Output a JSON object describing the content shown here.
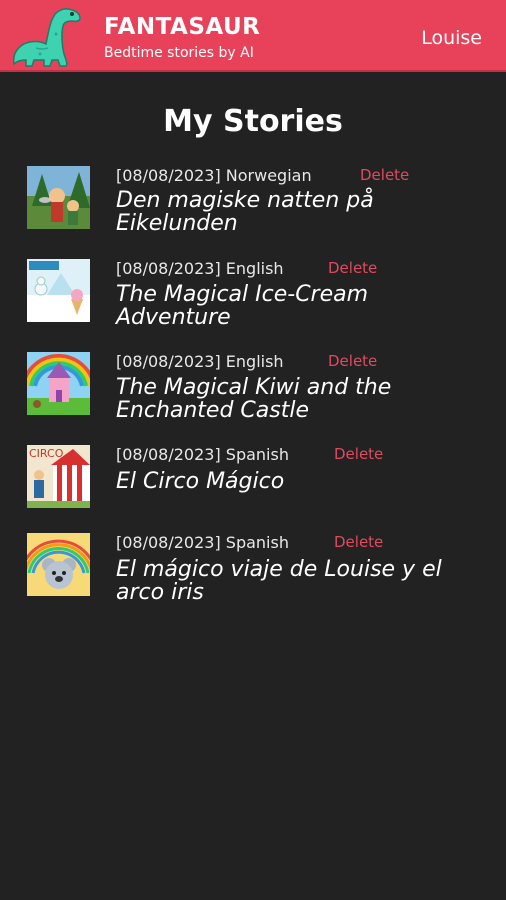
{
  "header": {
    "brand_title": "FANTASAUR",
    "brand_subtitle": "Bedtime stories by AI",
    "user_name": "Louise",
    "accent_color": "#e8425a"
  },
  "page": {
    "title": "My Stories"
  },
  "stories": [
    {
      "meta": "[08/08/2023] Norwegian",
      "title": "Den magiske natten på Eikelunden",
      "delete_label": "Delete",
      "thumbnail": "forest-fairies-illustration"
    },
    {
      "meta": "[08/08/2023] English",
      "title": "The Magical Ice-Cream Adventure",
      "delete_label": "Delete",
      "thumbnail": "ice-cream-snow-illustration"
    },
    {
      "meta": "[08/08/2023] English",
      "title": "The Magical Kiwi and the Enchanted Castle",
      "delete_label": "Delete",
      "thumbnail": "rainbow-castle-illustration"
    },
    {
      "meta": "[08/08/2023] Spanish",
      "title": "El Circo Mágico",
      "delete_label": "Delete",
      "thumbnail": "circus-tent-illustration"
    },
    {
      "meta": "[08/08/2023] Spanish",
      "title": "El mágico viaje de Louise y el arco iris",
      "delete_label": "Delete",
      "thumbnail": "koala-rainbow-illustration"
    }
  ]
}
